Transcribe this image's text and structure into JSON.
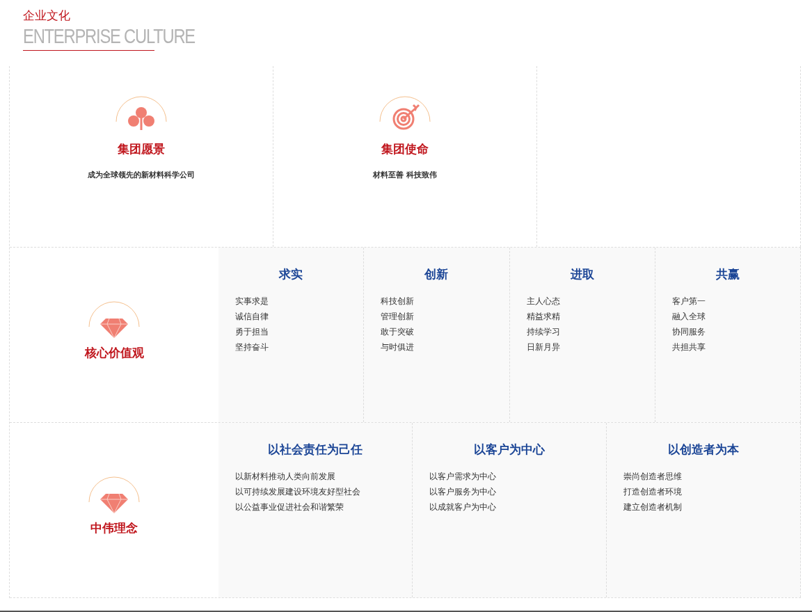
{
  "header": {
    "title": "企业文化",
    "subtitle": "ENTERPRISE CULTURE"
  },
  "top_cards": [
    {
      "kind": "clover",
      "title": "集团愿景",
      "text": "成为全球领先的新材料科学公司"
    },
    {
      "kind": "target",
      "title": "集团使命",
      "text": "材料至善 科技致伟"
    }
  ],
  "sections": [
    {
      "kind": "gem",
      "title": "核心价值观",
      "columns": [
        {
          "heading": "求实",
          "items": [
            "实事求是",
            "诚信自律",
            "勇于担当",
            "坚持奋斗"
          ]
        },
        {
          "heading": "创新",
          "items": [
            "科技创新",
            "管理创新",
            "敢于突破",
            "与时俱进"
          ]
        },
        {
          "heading": "进取",
          "items": [
            "主人心态",
            "精益求精",
            "持续学习",
            "日新月异"
          ]
        },
        {
          "heading": "共赢",
          "items": [
            "客户第一",
            "融入全球",
            "协同服务",
            "共担共享"
          ]
        }
      ]
    },
    {
      "kind": "gem",
      "title": "中伟理念",
      "columns": [
        {
          "heading": "以社会责任为己任",
          "items": [
            "以新材料推动人类向前发展",
            "以可持续发展建设环境友好型社会",
            "以公益事业促进社会和谐繁荣"
          ]
        },
        {
          "heading": "以客户为中心",
          "items": [
            "以客户需求为中心",
            "以客户服务为中心",
            "以成就客户为中心"
          ]
        },
        {
          "heading": "以创造者为本",
          "items": [
            "崇尚创造者思维",
            "打造创造者环境",
            "建立创造者机制"
          ]
        }
      ]
    }
  ]
}
